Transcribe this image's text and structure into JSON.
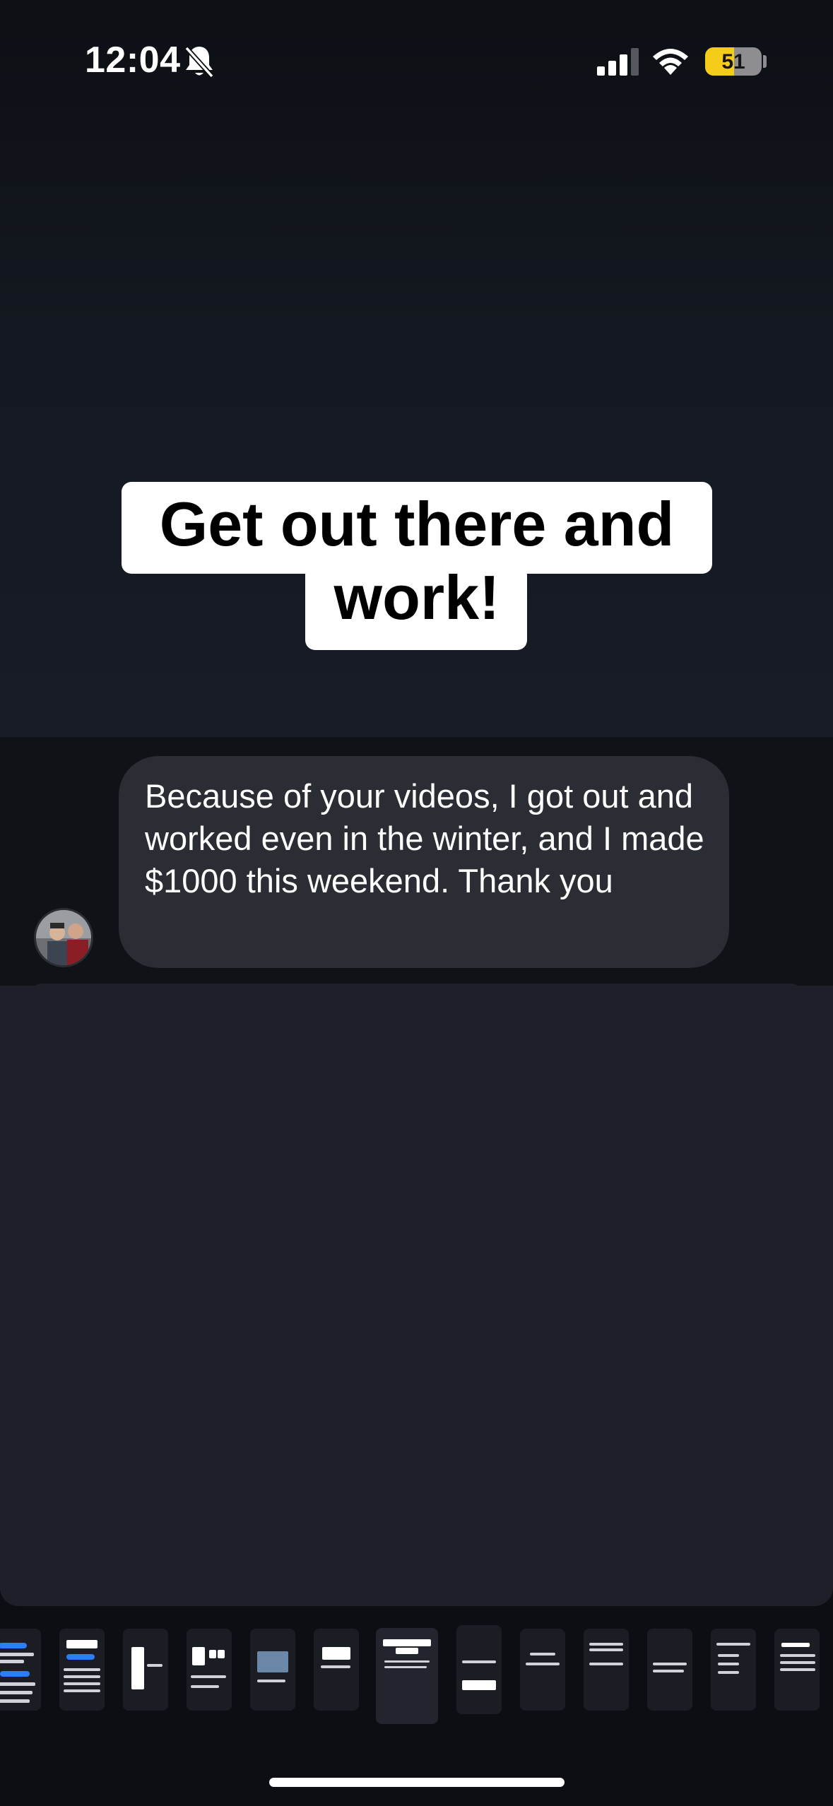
{
  "status_bar": {
    "time": "12:04",
    "battery_percent": "51",
    "battery_level": 0.51,
    "icons": [
      "bell-slash-icon",
      "cellular-signal-icon",
      "wifi-icon",
      "battery-icon"
    ]
  },
  "slide": {
    "headline": "Get out there and\nwork!"
  },
  "comment": {
    "text": "Because of your videos, I got out and worked even in the winter, and I made $1000 this weekend. Thank you",
    "avatar": "user-avatar"
  },
  "thumbnails": {
    "count": 13,
    "selected_index": 6
  },
  "colors": {
    "background": "#0c0e13",
    "bubble": "#2a2d33",
    "panel": "#1d2028",
    "battery": "#f5cc1a"
  }
}
